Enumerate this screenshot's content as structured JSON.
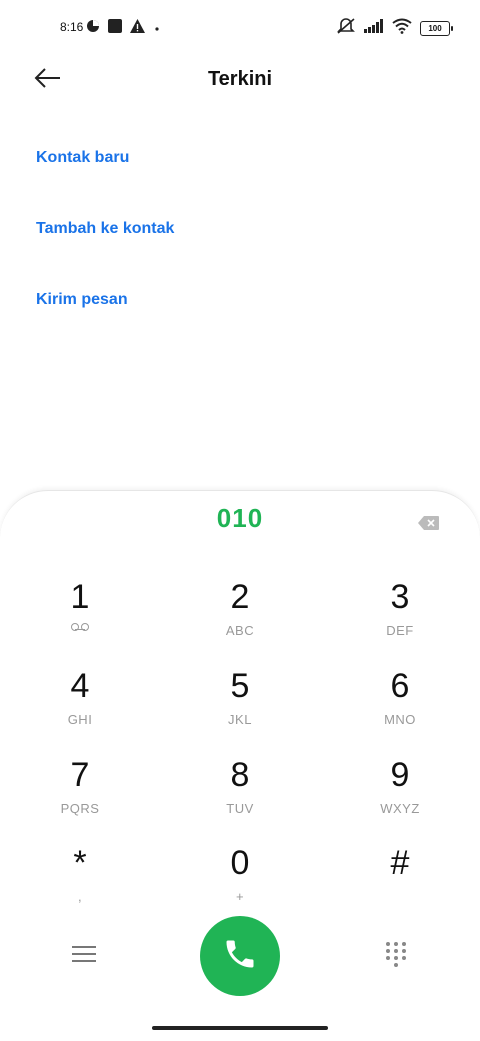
{
  "status_bar": {
    "time": "8:16",
    "battery": "100",
    "icons": [
      "data-saver-icon",
      "square-app-icon",
      "warning-icon",
      "dot-icon",
      "mute-icon",
      "signal-icon",
      "wifi-icon",
      "battery-icon"
    ]
  },
  "header": {
    "title": "Terkini",
    "back_icon": "back-arrow-icon"
  },
  "options": [
    {
      "label": "Kontak baru"
    },
    {
      "label": "Tambah ke kontak"
    },
    {
      "label": "Kirim pesan"
    }
  ],
  "dialer": {
    "number": "010",
    "keys": [
      {
        "digit": "1",
        "letters": ""
      },
      {
        "digit": "2",
        "letters": "ABC"
      },
      {
        "digit": "3",
        "letters": "DEF"
      },
      {
        "digit": "4",
        "letters": "GHI"
      },
      {
        "digit": "5",
        "letters": "JKL"
      },
      {
        "digit": "6",
        "letters": "MNO"
      },
      {
        "digit": "7",
        "letters": "PQRS"
      },
      {
        "digit": "8",
        "letters": "TUV"
      },
      {
        "digit": "9",
        "letters": "WXYZ"
      },
      {
        "digit": "*",
        "letters": ","
      },
      {
        "digit": "0",
        "letters": "+"
      },
      {
        "digit": "#",
        "letters": ""
      }
    ]
  },
  "colors": {
    "accent_blue": "#1a73e8",
    "call_green": "#20b455"
  }
}
